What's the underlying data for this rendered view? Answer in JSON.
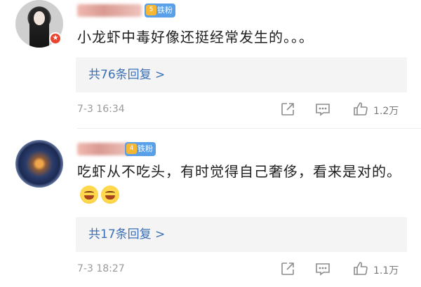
{
  "comments": [
    {
      "badge": "铁粉",
      "level": "5",
      "text": "小龙虾中毒好像还挺经常发生的。。。",
      "replies_label": "共76条回复 >",
      "time": "7-3 16:34",
      "likes": "1.2万"
    },
    {
      "badge": "铁粉",
      "level": "4",
      "text": "吃虾从不吃头，有时觉得自己奢侈，看来是对的。",
      "replies_label": "共17条回复 >",
      "time": "7-3 18:27",
      "likes": "1.1万"
    }
  ],
  "colors": {
    "link": "#3c6fb5",
    "badge": "#5aa0e8",
    "reply_bg": "#f4f4f4",
    "meta": "#9a9a9a"
  },
  "icons": [
    "share-icon",
    "comment-icon",
    "like-icon",
    "emoji-grin-icon",
    "verified-star-icon"
  ]
}
